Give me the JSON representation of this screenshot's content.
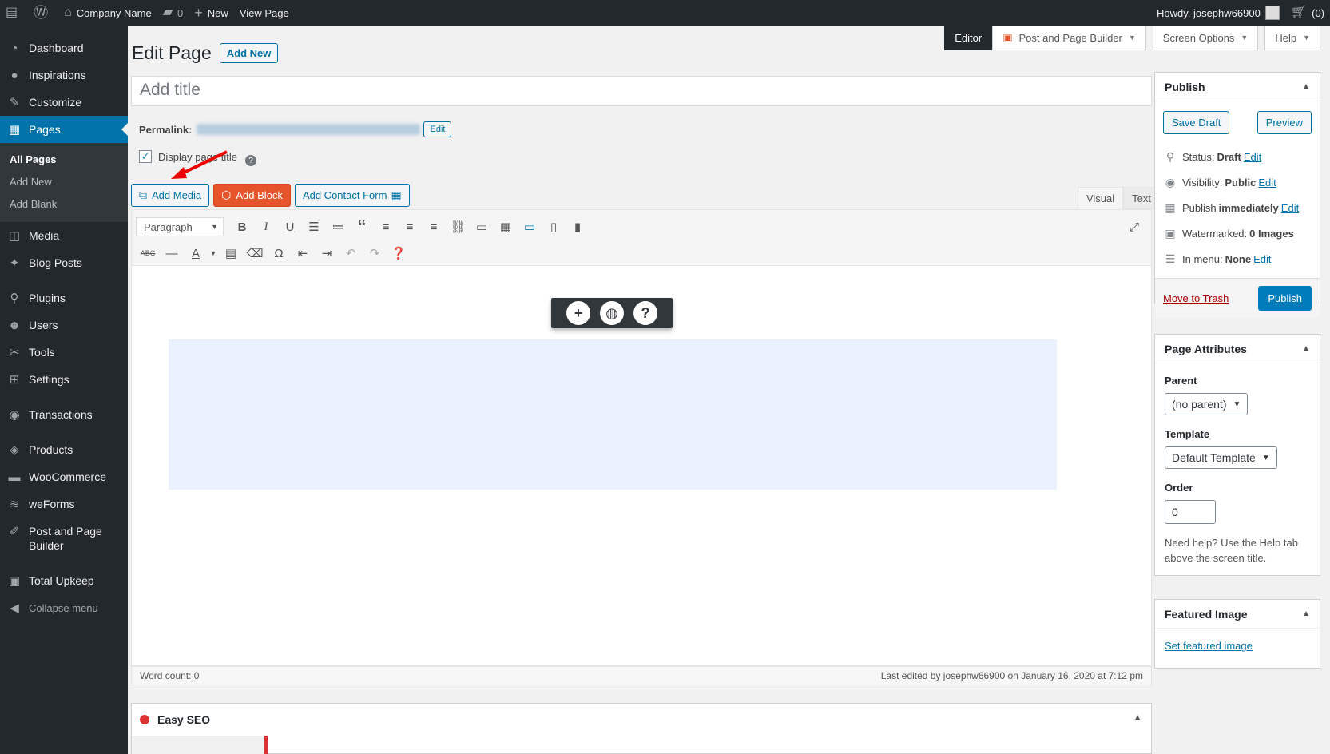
{
  "adminbar": {
    "site_name": "Company Name",
    "comments_count": "0",
    "new_label": "New",
    "view_page": "View Page",
    "howdy": "Howdy, josephw66900",
    "cart": "(0)"
  },
  "sidebar": {
    "items": [
      {
        "label": "Dashboard",
        "icon": "dashboard-icon"
      },
      {
        "label": "Inspirations",
        "icon": "lightbulb-icon"
      },
      {
        "label": "Customize",
        "icon": "brush-icon"
      },
      {
        "label": "Pages",
        "icon": "pages-icon"
      }
    ],
    "pages_sub": [
      "All Pages",
      "Add New",
      "Add Blank"
    ],
    "items2": [
      {
        "label": "Media",
        "icon": "media-icon"
      },
      {
        "label": "Blog Posts",
        "icon": "pin-icon"
      },
      {
        "label": "Plugins",
        "icon": "plugins-icon"
      },
      {
        "label": "Users",
        "icon": "users-icon"
      },
      {
        "label": "Tools",
        "icon": "tools-icon"
      },
      {
        "label": "Settings",
        "icon": "settings-icon"
      },
      {
        "label": "Transactions",
        "icon": "transactions-icon"
      },
      {
        "label": "Products",
        "icon": "products-icon"
      },
      {
        "label": "WooCommerce",
        "icon": "woocommerce-icon"
      },
      {
        "label": "weForms",
        "icon": "weforms-icon"
      },
      {
        "label": "Post and Page Builder",
        "icon": "builder-icon"
      },
      {
        "label": "Total Upkeep",
        "icon": "upkeep-icon"
      }
    ],
    "collapse": "Collapse menu"
  },
  "screen_tabs": {
    "editor": "Editor",
    "builder": "Post and Page Builder",
    "screen_options": "Screen Options",
    "help": "Help"
  },
  "page": {
    "title": "Edit Page",
    "add_new": "Add New",
    "title_placeholder": "Add title",
    "permalink_label": "Permalink:",
    "permalink_edit": "Edit",
    "display_title": "Display page title",
    "help_mark": "?"
  },
  "media_buttons": {
    "add_media": "Add Media",
    "add_block": "Add Block",
    "add_contact_form": "Add Contact Form"
  },
  "editor_tabs": {
    "visual": "Visual",
    "text": "Text"
  },
  "toolbar": {
    "format": "Paragraph"
  },
  "status_bar": {
    "word_count": "Word count: 0",
    "last_edited": "Last edited by josephw66900 on January 16, 2020 at 7:12 pm"
  },
  "seo": {
    "title": "Easy SEO"
  },
  "publish": {
    "title": "Publish",
    "save_draft": "Save Draft",
    "preview": "Preview",
    "status_label": "Status:",
    "status_value": "Draft",
    "visibility_label": "Visibility:",
    "visibility_value": "Public",
    "publish_label": "Publish",
    "publish_value": "immediately",
    "watermarked_label": "Watermarked:",
    "watermarked_value": "0 Images",
    "menu_label": "In menu:",
    "menu_value": "None",
    "edit": "Edit",
    "trash": "Move to Trash",
    "publish_btn": "Publish"
  },
  "page_attributes": {
    "title": "Page Attributes",
    "parent_label": "Parent",
    "parent_value": "(no parent)",
    "template_label": "Template",
    "template_value": "Default Template",
    "order_label": "Order",
    "order_value": "0",
    "help": "Need help? Use the Help tab above the screen title."
  },
  "featured": {
    "title": "Featured Image",
    "set": "Set featured image"
  },
  "colors": {
    "accent": "#0073aa",
    "admin_dark": "#23282d",
    "orange": "#e6542b",
    "danger": "#dc3232"
  }
}
